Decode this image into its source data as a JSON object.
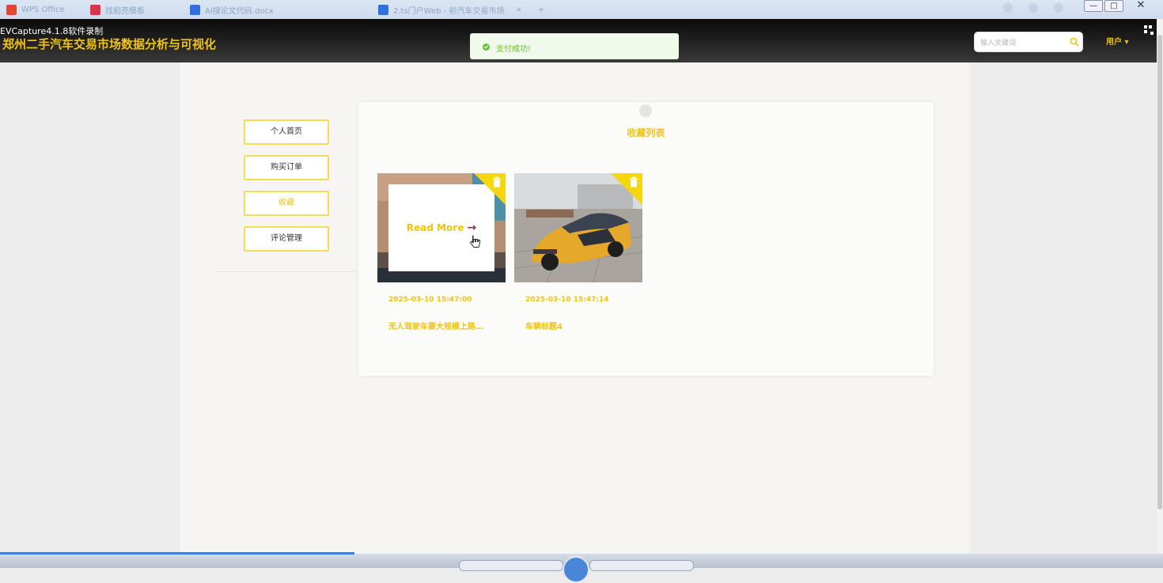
{
  "browser": {
    "tabs": [
      {
        "label": "WPS Office",
        "icon": "wps-icon",
        "color": "#e0472e"
      },
      {
        "label": "找稻壳模板",
        "icon": "docer-icon",
        "color": "#d9344a"
      },
      {
        "label": "AI搜论文代码.docx",
        "icon": "doc-icon",
        "color": "#2f6fe0"
      },
      {
        "label": "2.ts门户Web - 前汽车交易市场",
        "icon": "doc-icon",
        "color": "#2f6fe0"
      }
    ],
    "window_controls": [
      "—",
      "□",
      "✕"
    ]
  },
  "recorder_label": "EVCapture4.1.8软件录制",
  "site": {
    "title": "郑州二手汽车交易市场数据分析与可视化",
    "search_placeholder": "输入关键词",
    "user_menu": "用户 ▾"
  },
  "toast": {
    "message": "支付成功!"
  },
  "sidebar": {
    "items": [
      {
        "label": "个人首页",
        "active": false
      },
      {
        "label": "购买订单",
        "active": false
      },
      {
        "label": "收藏",
        "active": true
      },
      {
        "label": "评论管理",
        "active": false
      }
    ]
  },
  "favorites": {
    "title": "收藏列表",
    "items": [
      {
        "date": "2025-03-10 15:47:00",
        "title": "无人驾驶车要大规模上路…",
        "read_more": "Read More",
        "hovered": true
      },
      {
        "date": "2025-03-10 15:47:14",
        "title": "车辆标题4",
        "hovered": false
      }
    ]
  },
  "colors": {
    "accent": "#f1c40f",
    "success": "#67c23a",
    "header_bg": "#1a1a1a"
  }
}
